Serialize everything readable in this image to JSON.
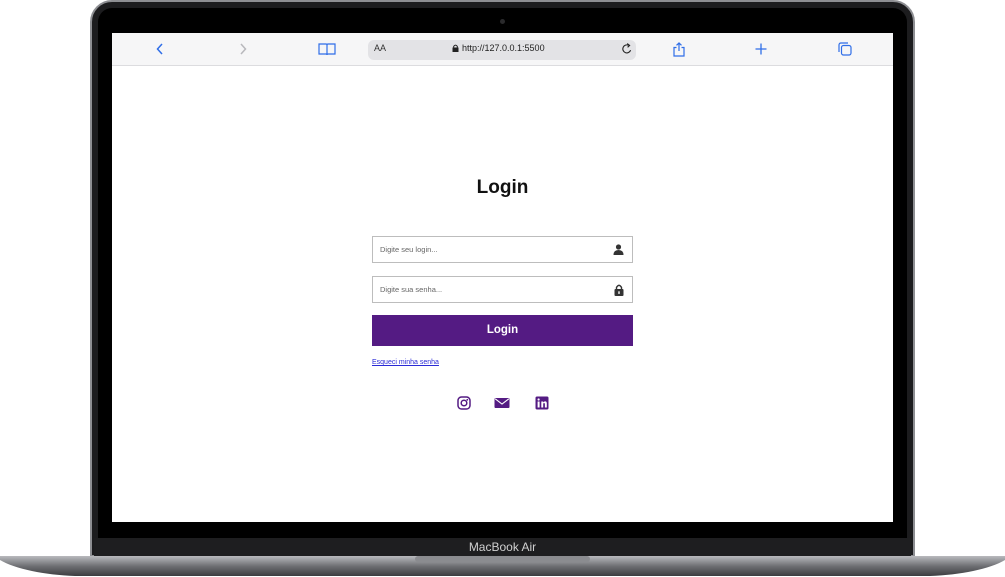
{
  "device": {
    "label": "MacBook Air"
  },
  "browser": {
    "text_size_label": "AA",
    "url": "http://127.0.0.1:5500",
    "icons": [
      "chevron-left-icon",
      "chevron-right-icon",
      "book-icon",
      "lock-icon",
      "reload-icon",
      "share-icon",
      "plus-icon",
      "tabs-icon"
    ]
  },
  "login": {
    "title": "Login",
    "username_placeholder": "Digite seu login...",
    "password_placeholder": "Digite sua senha...",
    "button_label": "Login",
    "forgot_link": "Esqueci minha senha"
  },
  "social": [
    "instagram-icon",
    "mail-icon",
    "linkedin-icon"
  ],
  "colors": {
    "accent": "#541b83",
    "link": "#2a2ad6",
    "frame": "#1c1c1e"
  }
}
